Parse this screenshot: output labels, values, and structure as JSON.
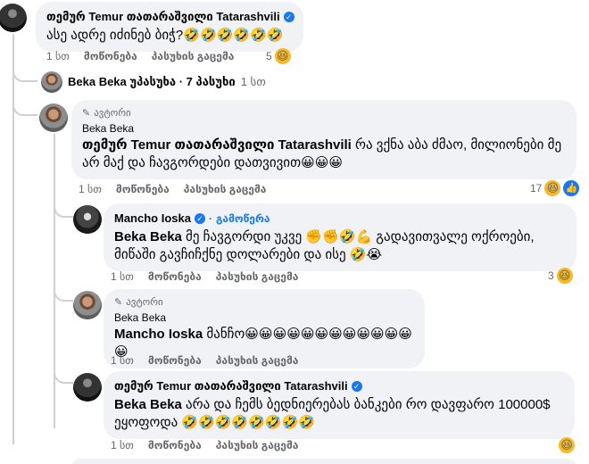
{
  "c1": {
    "author": "თემურ Temur თათარაშვილი Tatarashvili",
    "text": "ასე ადრე იძინებ ბიჭ?🤣🤣🤣🤣🤣🤣",
    "time": "1 სთ",
    "like": "მოწონება",
    "reply": "პასუხის გაცემა",
    "react_count": "5"
  },
  "summary": {
    "text": "Beka Beka უპასუხა · 7 პასუხი",
    "time": "1 სთ"
  },
  "r1": {
    "badge": "ავტორი",
    "author": "Beka Beka",
    "mention": "თემურ Temur თათარაშვილი Tatarashvili",
    "text": " რა ვქნა აბა ძმაო, მილიონები მე არ მაქ და ჩავგორდები დათვივით😀😀😀",
    "time": "1 სთ",
    "like": "მოწონება",
    "reply": "პასუხის გაცემა",
    "react_count": "17"
  },
  "r2": {
    "author": "Mancho Ioska",
    "follow": "გამოწერა",
    "mention": "Beka Beka",
    "text": " მე ჩავგორდი უკვე ✊✊🤣💪 გადავითვალე ოქროები, მიწაში გავჩიჩქნე დოლარები და ისე 🤣😭",
    "time": "1 სთ",
    "like": "მოწონება",
    "reply": "პასუხის გაცემა",
    "react_count": "3"
  },
  "r3": {
    "badge": "ავტორი",
    "author": "Beka Beka",
    "mention": "Mancho Ioska",
    "text": " მანჩო😀😀😀😀😀😀😀😀😀😀😀😀😀",
    "time": "1 სთ",
    "like": "მოწონება",
    "reply": "პასუხის გაცემა"
  },
  "r4": {
    "author": "თემურ Temur თათარაშვილი Tatarashvili",
    "mention": "Beka Beka",
    "text": " არა და ჩემს ბედნიერებას ბანკები რო დავფარო 100000$ ეყოფოდა 🤣🤣🤣🤣🤣🤣🤣🤣",
    "time": "1 სთ",
    "like": "მოწონება",
    "reply": "პასუხის გაცემა"
  },
  "icons": {
    "haha": "😆",
    "like": "👍",
    "check": "✓",
    "pencil": "✎"
  },
  "colors": {
    "bubble": "#f0f2f5",
    "link": "#1877f2",
    "meta": "#65676b",
    "line": "#ced0d4"
  }
}
